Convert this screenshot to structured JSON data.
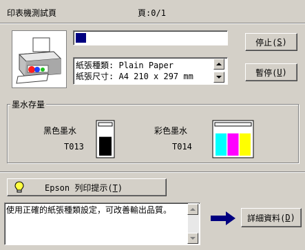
{
  "header": {
    "title": "印表機測試頁",
    "page_label": "頁",
    "page_value": ":0/1"
  },
  "progress": {
    "fraction": 0.07,
    "color": "#000080"
  },
  "paper_info": {
    "type_label": "紙張種類",
    "type_value": ": Plain Paper",
    "size_label": "紙張尺寸",
    "size_value": ": A4 210 x 297 mm"
  },
  "buttons": {
    "stop": {
      "label": "停止(",
      "key": "S",
      "suffix": ")"
    },
    "pause": {
      "label": "暫停(",
      "key": "U",
      "suffix": ")"
    },
    "tips": {
      "label": "Epson 列印提示(",
      "key": "T",
      "suffix": ")"
    },
    "details": {
      "label": "詳細資料(",
      "key": "D",
      "suffix": ")"
    }
  },
  "ink": {
    "group_title": "墨水存量",
    "black": {
      "label": "黑色墨水",
      "code": "T013",
      "level": 0.72,
      "color": "#000000"
    },
    "color": {
      "label": "彩色墨水",
      "code": "T014",
      "colors": [
        "#00ffff",
        "#ff00ff",
        "#ffff00"
      ],
      "levels": [
        0.85,
        0.85,
        0.85
      ]
    }
  },
  "tip_text": "使用正確的紙張種類設定，可改善輸出品質。",
  "icons": [
    "printer-icon",
    "lightbulb-icon",
    "arrow-right-icon"
  ]
}
